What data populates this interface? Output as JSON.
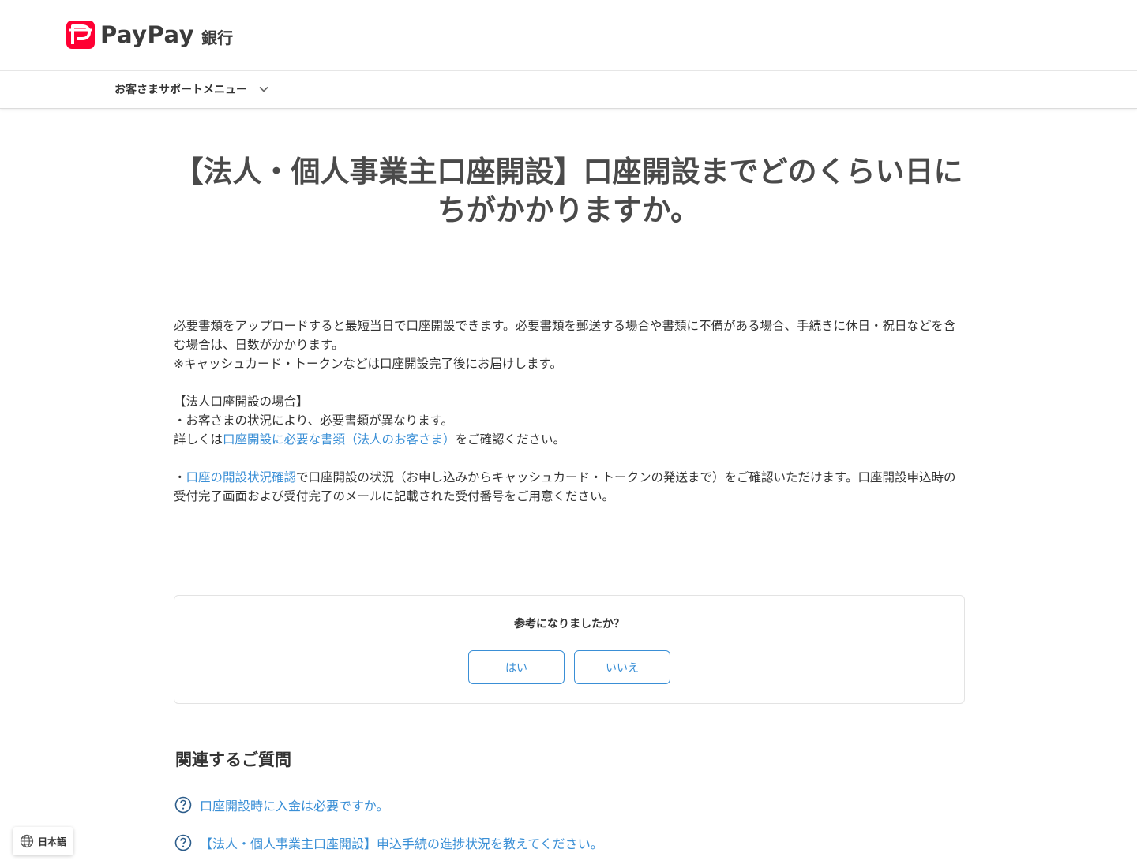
{
  "header": {
    "logo_text": "PayPay",
    "logo_sub": "銀行",
    "brand_color": "#ff0033"
  },
  "support_menu": {
    "label": "お客さまサポートメニュー",
    "icon": "chevron-down-icon"
  },
  "page_title_line1": "【法人・個人事業主口座開設】口座開設までどのくらい日に",
  "page_title_line2": "ちがかかりますか。",
  "article": {
    "p1": "必要書類をアップロードすると最短当日で口座開設できます。必要書類を郵送する場合や書類に不備がある場合、手続きに休日・祝日などを含む場合は、日数がかかります。",
    "p2": "※キャッシュカード・トークンなどは口座開設完了後にお届けします。",
    "section_heading": "【法人口座開設の場合】",
    "bullet1": "・お客さまの状況により、必要書類が異なります。",
    "detail_prefix": "詳しくは",
    "detail_link": "口座開設に必要な書類（法人のお客さま）",
    "detail_suffix": "をご確認ください。",
    "bullet2_prefix": "・",
    "bullet2_link": "口座の開設状況確認",
    "bullet2_suffix": "で口座開設の状況（お申し込みからキャッシュカード・トークンの発送まで）をご確認いただけます。口座開設申込時の受付完了画面および受付完了のメールに記載された受付番号をご用意ください。"
  },
  "feedback": {
    "question": "参考になりましたか？",
    "yes_label": "はい",
    "no_label": "いいえ"
  },
  "related": {
    "title": "関連するご質問",
    "items": [
      {
        "label": "口座開設時に入金は必要ですか。",
        "icon": "question-circle-icon"
      },
      {
        "label": "【法人・個人事業主口座開設】申込手続の進捗状況を教えてください。",
        "icon": "question-circle-icon"
      }
    ]
  },
  "language": {
    "label": "日本語",
    "icon": "globe-icon"
  },
  "colors": {
    "link": "#3a8fd6",
    "title": "#4a4a4a",
    "text": "#333333"
  }
}
